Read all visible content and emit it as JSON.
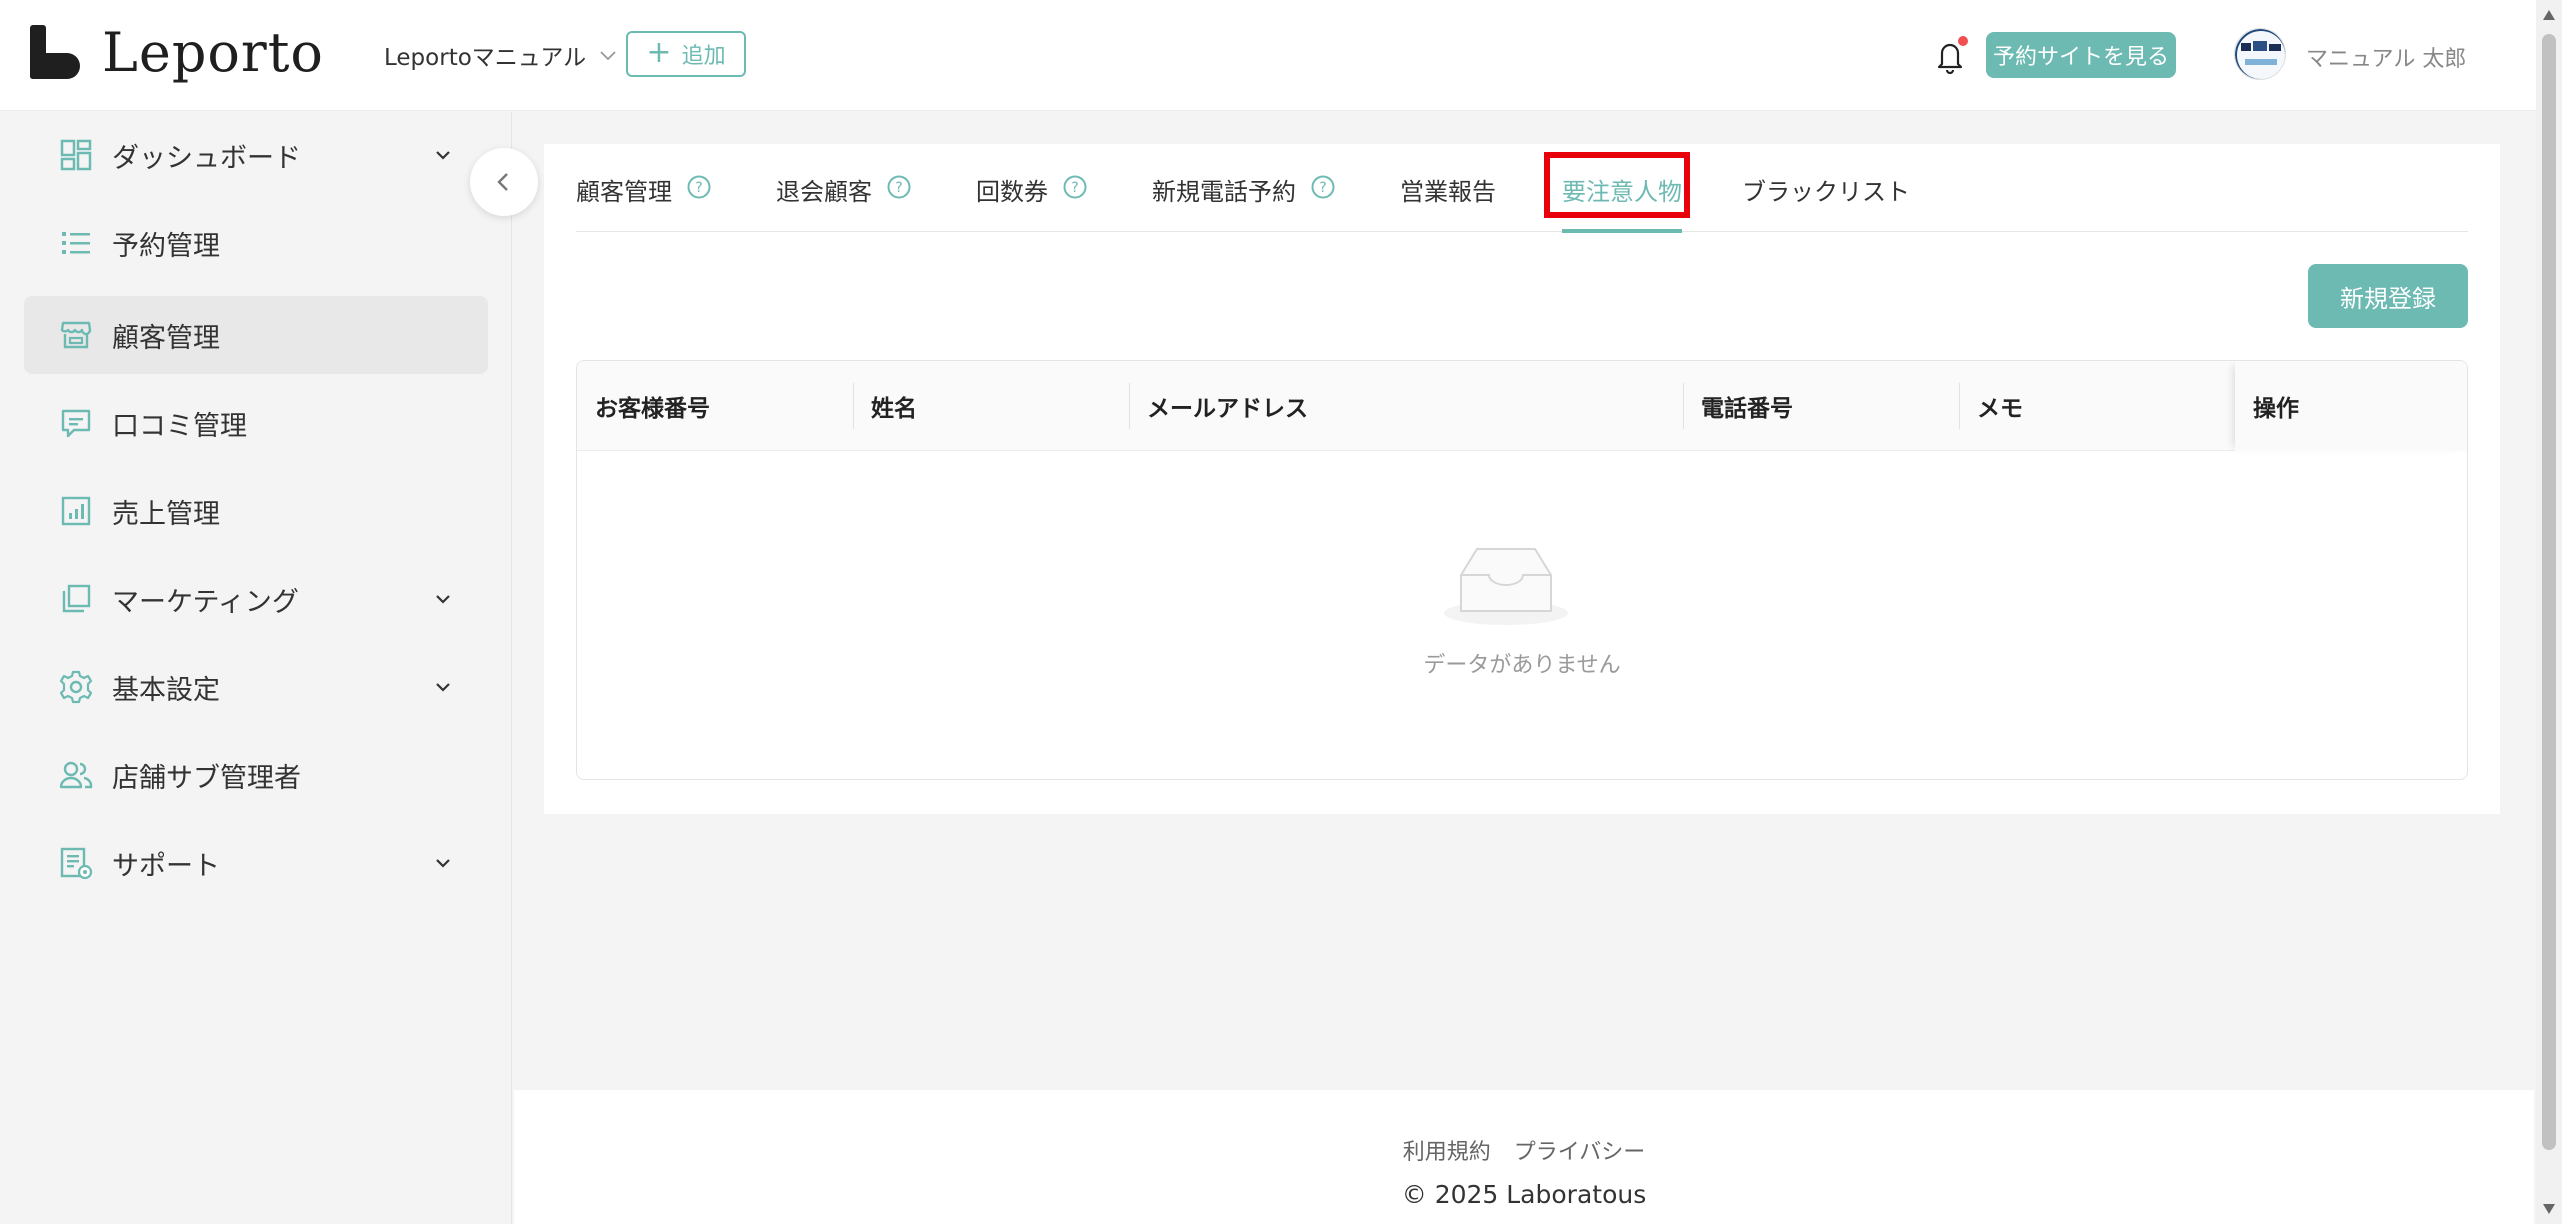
{
  "header": {
    "logo_text": "Leporto",
    "shop_name": "Leportoマニュアル",
    "add_label": "追加",
    "view_site_label": "予約サイトを見る",
    "user_name": "マニュアル 太郎"
  },
  "sidebar": {
    "items": [
      {
        "label": "ダッシュボード",
        "icon": "dashboard-icon",
        "expandable": true
      },
      {
        "label": "予約管理",
        "icon": "list-icon",
        "expandable": false
      },
      {
        "label": "顧客管理",
        "icon": "store-icon",
        "expandable": false,
        "active": true
      },
      {
        "label": "口コミ管理",
        "icon": "comment-icon",
        "expandable": false
      },
      {
        "label": "売上管理",
        "icon": "bar-chart-icon",
        "expandable": false
      },
      {
        "label": "マーケティング",
        "icon": "layers-icon",
        "expandable": true
      },
      {
        "label": "基本設定",
        "icon": "gear-icon",
        "expandable": true
      },
      {
        "label": "店舗サブ管理者",
        "icon": "users-icon",
        "expandable": false
      },
      {
        "label": "サポート",
        "icon": "document-icon",
        "expandable": true
      }
    ]
  },
  "tabs": [
    {
      "label": "顧客管理",
      "help": true
    },
    {
      "label": "退会顧客",
      "help": true
    },
    {
      "label": "回数券",
      "help": true
    },
    {
      "label": "新規電話予約",
      "help": true
    },
    {
      "label": "営業報告",
      "help": false
    },
    {
      "label": "要注意人物",
      "help": false,
      "active": true
    },
    {
      "label": "ブラックリスト",
      "help": false
    }
  ],
  "new_button_label": "新規登録",
  "table": {
    "columns": [
      "お客様番号",
      "姓名",
      "メールアドレス",
      "電話番号",
      "メモ",
      "操作"
    ],
    "rows": [],
    "empty_text": "データがありません"
  },
  "footer": {
    "terms": "利用規約",
    "privacy": "プライバシー",
    "copyright": "2025 Laboratous"
  },
  "colors": {
    "accent": "#6dbab3",
    "highlight": "#e8000b",
    "notification_dot": "#f0504f"
  }
}
